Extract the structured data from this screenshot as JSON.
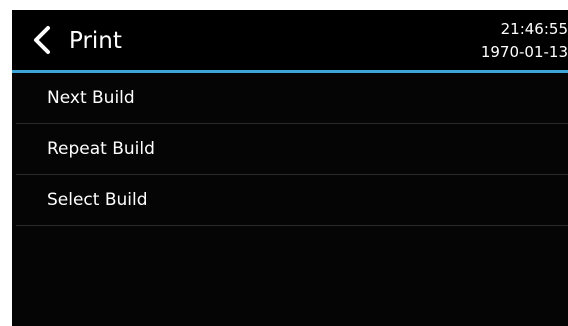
{
  "header": {
    "title": "Print",
    "time": "21:46:55",
    "date": "1970-01-13"
  },
  "menu": {
    "items": [
      {
        "label": "Next Build"
      },
      {
        "label": "Repeat Build"
      },
      {
        "label": "Select Build"
      }
    ]
  },
  "colors": {
    "accent": "#3da6d8",
    "background": "#050505",
    "header_background": "#000000",
    "divider": "#2a2a2a",
    "text": "#ffffff"
  },
  "icons": {
    "back": "chevron-left-icon"
  }
}
